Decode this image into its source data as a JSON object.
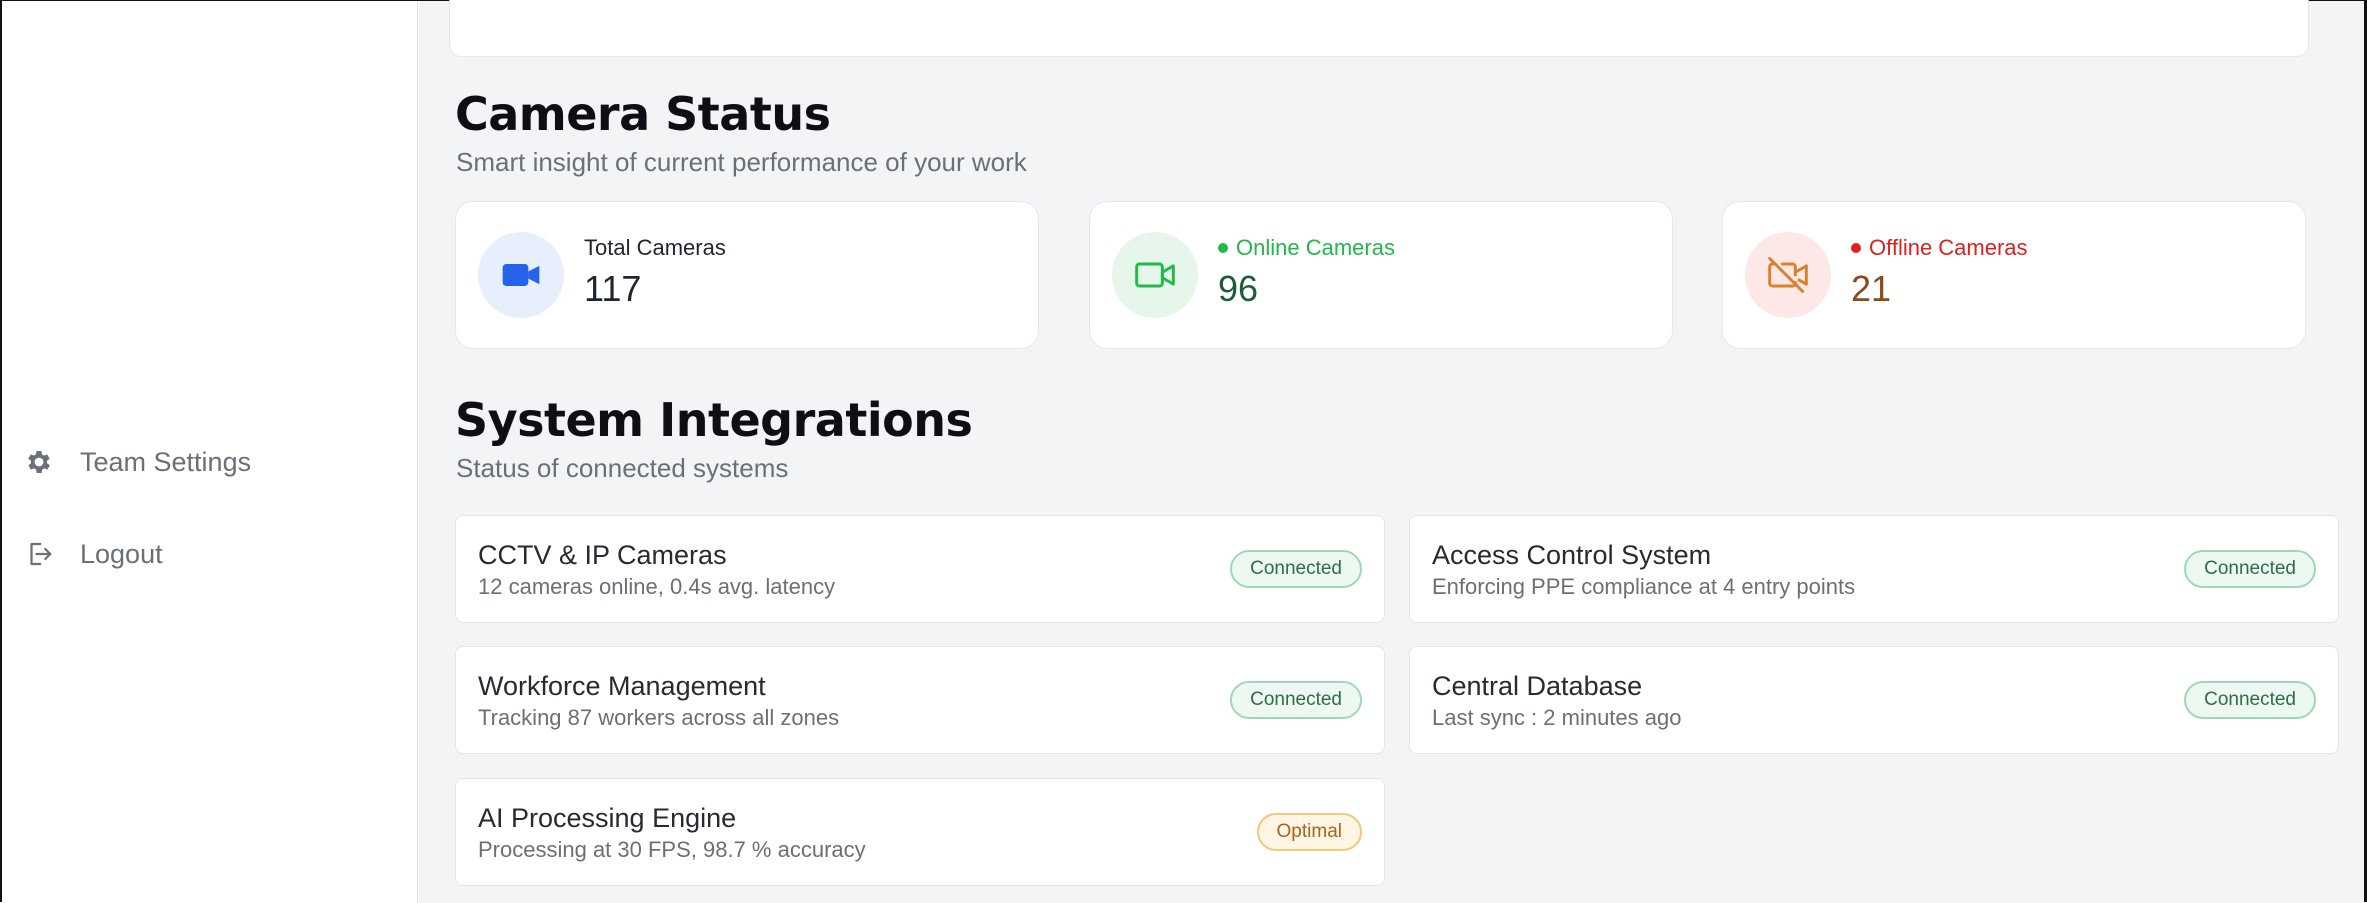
{
  "sidebar": {
    "items": [
      {
        "label": "Team Settings",
        "icon": "gear-icon"
      },
      {
        "label": "Logout",
        "icon": "logout-icon"
      }
    ]
  },
  "camera_status": {
    "title": "Camera Status",
    "subtitle": "Smart insight of current performance of your work",
    "cards": [
      {
        "label": "Total Cameras",
        "value": "117",
        "icon": "video-camera-icon",
        "accent": "#2563eb",
        "icon_bg": "#e8effc",
        "label_color": "#1f2430",
        "value_color": "#1f2430"
      },
      {
        "label": "Online Cameras",
        "value": "96",
        "icon": "video-camera-outline-icon",
        "accent": "#22b84a",
        "icon_bg": "#e6f6ea",
        "label_color": "#22b84a",
        "value_color": "#1e5c36"
      },
      {
        "label": "Offline Cameras",
        "value": "21",
        "icon": "video-camera-off-icon",
        "accent": "#e02020",
        "icon_bg": "#fde8e8",
        "label_color": "#e02020",
        "value_color": "#8a4a1a"
      }
    ]
  },
  "integrations": {
    "title": "System Integrations",
    "subtitle": "Status of connected systems",
    "items": [
      {
        "name": "CCTV & IP Cameras",
        "desc": "12 cameras online, 0.4s avg. latency",
        "status": "Connected"
      },
      {
        "name": "Access Control System",
        "desc": "Enforcing PPE compliance at 4 entry points",
        "status": "Connected"
      },
      {
        "name": "Workforce Management",
        "desc": "Tracking 87 workers across all zones",
        "status": "Connected"
      },
      {
        "name": "Central Database",
        "desc": "Last sync : 2 minutes ago",
        "status": "Connected"
      },
      {
        "name": "AI Processing Engine",
        "desc": "Processing at 30 FPS, 98.7 % accuracy",
        "status": "Optimal"
      }
    ]
  }
}
